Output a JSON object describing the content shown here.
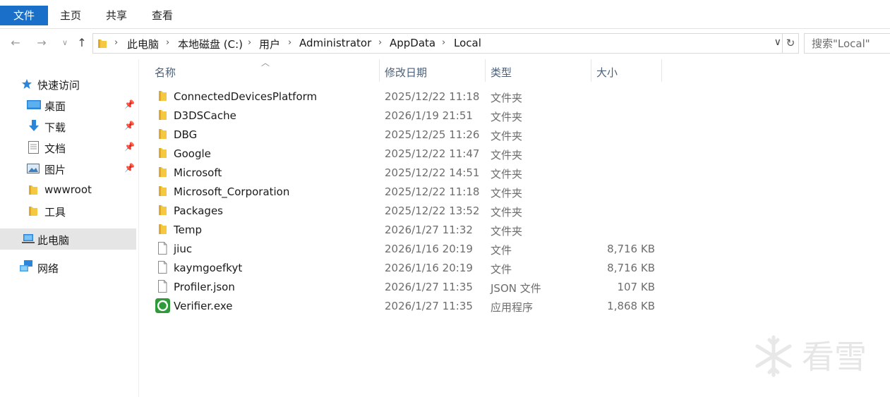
{
  "ribbon": {
    "tabs": [
      "文件",
      "主页",
      "共享",
      "查看"
    ]
  },
  "address": {
    "crumbs": [
      "此电脑",
      "本地磁盘 (C:)",
      "用户",
      "Administrator",
      "AppData",
      "Local"
    ]
  },
  "search": {
    "placeholder": "搜索\"Local\""
  },
  "nav": {
    "quick_access": "快速访问",
    "items": [
      "桌面",
      "下载",
      "文档",
      "图片",
      "wwwroot",
      "工具"
    ],
    "this_pc": "此电脑",
    "network": "网络"
  },
  "columns": {
    "name": "名称",
    "date": "修改日期",
    "type": "类型",
    "size": "大小"
  },
  "files": [
    {
      "name": "ConnectedDevicesPlatform",
      "date": "2025/12/22 11:18",
      "type": "文件夹",
      "size": "",
      "icon": "folder-icon"
    },
    {
      "name": "D3DSCache",
      "date": "2026/1/19 21:51",
      "type": "文件夹",
      "size": "",
      "icon": "folder-icon"
    },
    {
      "name": "DBG",
      "date": "2025/12/25 11:26",
      "type": "文件夹",
      "size": "",
      "icon": "folder-icon"
    },
    {
      "name": "Google",
      "date": "2025/12/22 11:47",
      "type": "文件夹",
      "size": "",
      "icon": "folder-icon"
    },
    {
      "name": "Microsoft",
      "date": "2025/12/22 14:51",
      "type": "文件夹",
      "size": "",
      "icon": "folder-icon"
    },
    {
      "name": "Microsoft_Corporation",
      "date": "2025/12/22 11:18",
      "type": "文件夹",
      "size": "",
      "icon": "folder-icon"
    },
    {
      "name": "Packages",
      "date": "2025/12/22 13:52",
      "type": "文件夹",
      "size": "",
      "icon": "folder-icon"
    },
    {
      "name": "Temp",
      "date": "2026/1/27 11:32",
      "type": "文件夹",
      "size": "",
      "icon": "folder-icon"
    },
    {
      "name": "jiuc",
      "date": "2026/1/16 20:19",
      "type": "文件",
      "size": "8,716 KB",
      "icon": "file-icon"
    },
    {
      "name": "kaymgoefkyt",
      "date": "2026/1/16 20:19",
      "type": "文件",
      "size": "8,716 KB",
      "icon": "file-icon"
    },
    {
      "name": "Profiler.json",
      "date": "2026/1/27 11:35",
      "type": "JSON 文件",
      "size": "107 KB",
      "icon": "file-icon"
    },
    {
      "name": "Verifier.exe",
      "date": "2026/1/27 11:35",
      "type": "应用程序",
      "size": "1,868 KB",
      "icon": "verifier-app-icon"
    }
  ],
  "watermark": {
    "text": "看雪"
  },
  "colors": {
    "accent": "#1a6fc9",
    "folder": "#f5c842",
    "selected": "#e5e5e5"
  }
}
